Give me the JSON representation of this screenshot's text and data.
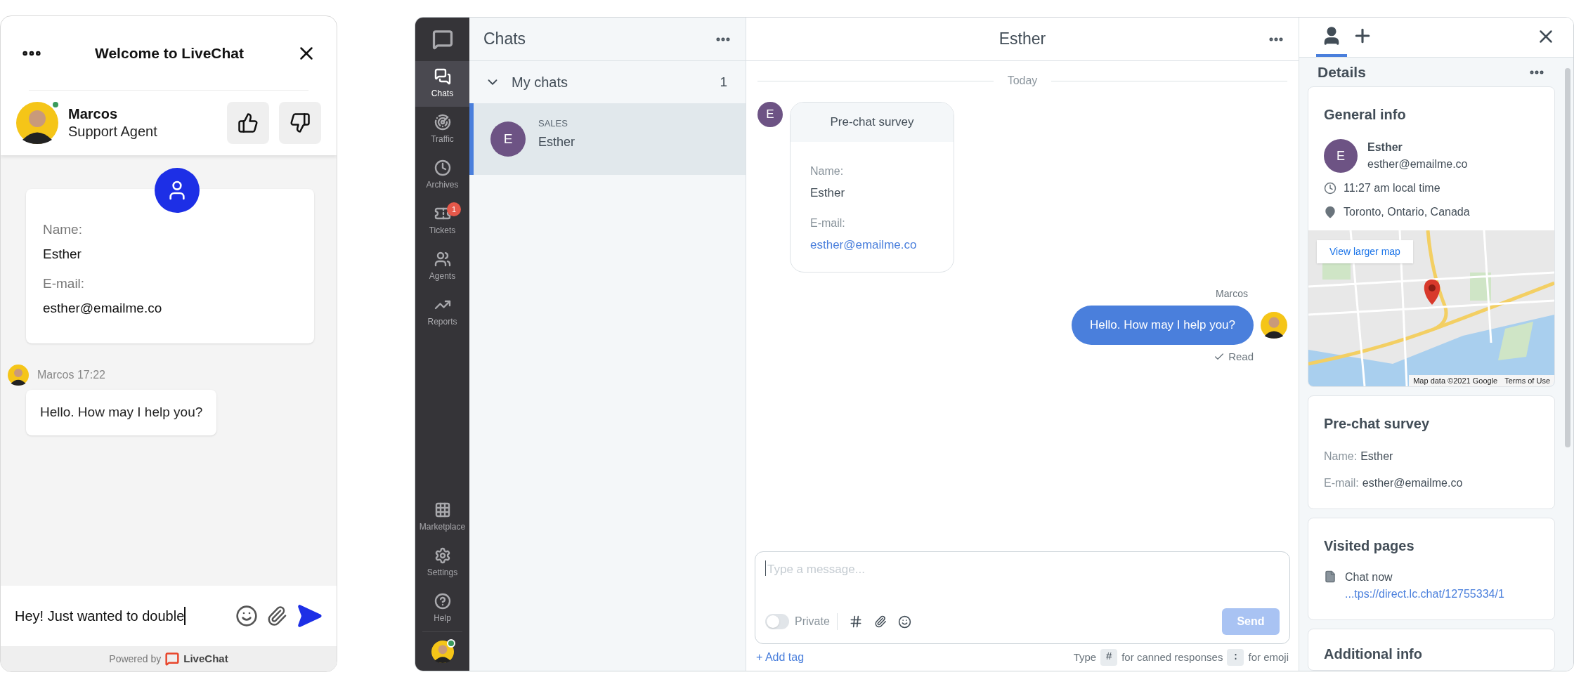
{
  "widget": {
    "title": "Welcome to LiveChat",
    "agent": {
      "name": "Marcos",
      "role": "Support Agent",
      "online": true
    },
    "survey": {
      "fields": [
        {
          "label": "Name:",
          "value": "Esther"
        },
        {
          "label": "E-mail:",
          "value": "esther@emailme.co"
        }
      ]
    },
    "message": {
      "meta": "Marcos 17:22",
      "text": "Hello. How may I help you?"
    },
    "input": {
      "value": "Hey! Just wanted to double"
    },
    "footer": {
      "prefix": "Powered by",
      "brand": "LiveChat"
    }
  },
  "app": {
    "nav": [
      {
        "label": "Chats",
        "selected": true
      },
      {
        "label": "Traffic",
        "selected": false
      },
      {
        "label": "Archives",
        "selected": false
      },
      {
        "label": "Tickets",
        "selected": false,
        "badge": "1"
      },
      {
        "label": "Agents",
        "selected": false
      },
      {
        "label": "Reports",
        "selected": false
      }
    ],
    "nav_bottom": [
      {
        "label": "Marketplace",
        "selected": false
      },
      {
        "label": "Settings",
        "selected": false
      },
      {
        "label": "Help",
        "selected": false
      }
    ],
    "chats": {
      "title": "Chats",
      "group": {
        "label": "My chats",
        "count": "1",
        "expanded": true
      },
      "items": [
        {
          "initial": "E",
          "tag": "SALES",
          "name": "Esther",
          "selected": true
        }
      ]
    },
    "conversation": {
      "title": "Esther",
      "divider": "Today",
      "survey": {
        "initial": "E",
        "title": "Pre-chat survey",
        "fields": [
          {
            "label": "Name:",
            "value": "Esther",
            "link": false
          },
          {
            "label": "E-mail:",
            "value": "esther@emailme.co",
            "link": true
          }
        ]
      },
      "reply": {
        "author": "Marcos",
        "text": "Hello. How may I help you?",
        "status": "Read"
      },
      "composer": {
        "placeholder": "Type a message...",
        "private": {
          "label": "Private",
          "on": false
        },
        "send": {
          "label": "Send",
          "disabled": true
        }
      },
      "add_tag": "+ Add tag",
      "hint": [
        {
          "text": "Type",
          "key": false
        },
        {
          "text": "#",
          "key": true
        },
        {
          "text": "for canned responses",
          "key": false
        },
        {
          "text": ":",
          "key": true
        },
        {
          "text": "for emoji",
          "key": false
        }
      ]
    },
    "details": {
      "tabs": [
        {
          "selected": true
        },
        {
          "selected": false
        }
      ],
      "title": "Details",
      "general": {
        "title": "General info",
        "initial": "E",
        "name": "Esther",
        "email": "esther@emailme.co",
        "time": "11:27 am local time",
        "location": "Toronto, Ontario, Canada",
        "map": {
          "kind": "picture",
          "button": "View larger map",
          "attribution": "Map data ©2021 Google",
          "terms": "Terms of Use"
        }
      },
      "survey": {
        "title": "Pre-chat survey",
        "fields": [
          {
            "label": "Name:",
            "value": "Esther"
          },
          {
            "label": "E-mail:",
            "value": "esther@emailme.co"
          }
        ]
      },
      "visited": {
        "title": "Visited pages",
        "pages": [
          {
            "title": "Chat now",
            "url": "...tps://direct.lc.chat/12755334/1"
          }
        ]
      },
      "additional": {
        "title": "Additional info"
      }
    }
  }
}
